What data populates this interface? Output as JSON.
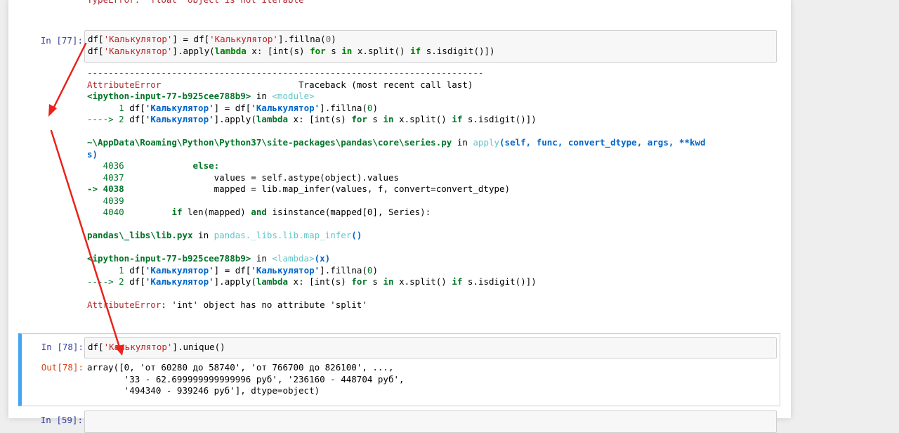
{
  "top_cell": {
    "partial_error": "TypeError: 'float' object is not iterable"
  },
  "cell77": {
    "prompt": "In [77]:",
    "code_line1": {
      "a": "df[",
      "s1": "'Калькулятор'",
      "b": "] ",
      "eq": "=",
      "c": " df[",
      "s2": "'Калькулятор'",
      "d": "].fillna(",
      "n": "0",
      "e": ")"
    },
    "code_line2": {
      "a": "df[",
      "s1": "'Калькулятор'",
      "b": "].apply(",
      "k1": "lambda",
      "c": " x: [int(s) ",
      "k2": "for",
      "d": " s ",
      "k3": "in",
      "e": " x.split() ",
      "k4": "if",
      "f": " s.isdigit()])"
    },
    "traceback": {
      "dashes": "---------------------------------------------------------------------------",
      "error_name": "AttributeError",
      "tb_header": "                          Traceback (most recent call last)",
      "frame1_file": "<ipython-input-77-b925cee788b9>",
      "frame1_in": " in ",
      "frame1_module": "<module>",
      "f1_l1_num": "      1 ",
      "f1_l1_code_a": "df[",
      "f1_l1_str": "'Калькулятор'",
      "f1_l1_code_b": "] = df[",
      "f1_l1_str2": "'Калькулятор'",
      "f1_l1_code_c": "].fillna(",
      "f1_l1_num0": "0",
      "f1_l1_code_d": ")",
      "f1_l2_arrow": "----> 2 ",
      "f1_l2_a": "df[",
      "f1_l2_str": "'Калькулятор'",
      "f1_l2_b": "].apply(",
      "f1_l2_kw1": "lambda",
      "f1_l2_c": " x: [int(s) ",
      "f1_l2_kw2": "for",
      "f1_l2_d": " s ",
      "f1_l2_kw3": "in",
      "f1_l2_e": " x.split() ",
      "f1_l2_kw4": "if",
      "f1_l2_f": " s.isdigit()])",
      "frame2_path": "~\\AppData\\Roaming\\Python\\Python37\\site-packages\\pandas\\core\\series.py",
      "frame2_in": " in ",
      "frame2_func": "apply",
      "frame2_args": "(self, func, convert_dtype, args, **kwd",
      "frame2_args_wrap": "s)",
      "f2_l4036_num": "   4036 ",
      "f2_l4036_code": "            else:",
      "f2_l4037_num": "   4037 ",
      "f2_l4037_code": "                values = self.astype(object).values",
      "f2_l4038_num": "-> 4038 ",
      "f2_l4038_code": "                mapped = lib.map_infer(values, f, convert=convert_dtype)",
      "f2_l4039_num": "   4039 ",
      "f2_l4040_num": "   4040 ",
      "f2_l4040_kw1": "if",
      "f2_l4040_a": " len(mapped) ",
      "f2_l4040_kw2": "and",
      "f2_l4040_b": " isinstance(mapped[0], Series):",
      "frame3_path": "pandas\\_libs\\lib.pyx",
      "frame3_in": " in ",
      "frame3_func": "pandas._libs.lib.map_infer",
      "frame3_parens": "()",
      "frame4_file": "<ipython-input-77-b925cee788b9>",
      "frame4_in": " in ",
      "frame4_lambda": "<lambda>",
      "frame4_args": "(x)",
      "final_error_name": "AttributeError",
      "final_error_msg": ": 'int' object has no attribute 'split'"
    }
  },
  "cell78": {
    "in_prompt": "In [78]:",
    "code": {
      "a": "df[",
      "s": "'Калькулятор'",
      "b": "].unique()"
    },
    "out_prompt": "Out[78]:",
    "output_lines": [
      "array([0, 'от 60280 до 58740', 'от 766700 до 826100', ...,",
      "       '33 - 62.699999999999996 руб', '236160 - 448704 руб',",
      "       '494340 - 939246 руб'], dtype=object)"
    ]
  },
  "cell_next": {
    "prompt": "In [59]:"
  },
  "colors": {
    "selected_cell_border": "#42a5f5",
    "annotation_arrow": "#e8231b"
  }
}
